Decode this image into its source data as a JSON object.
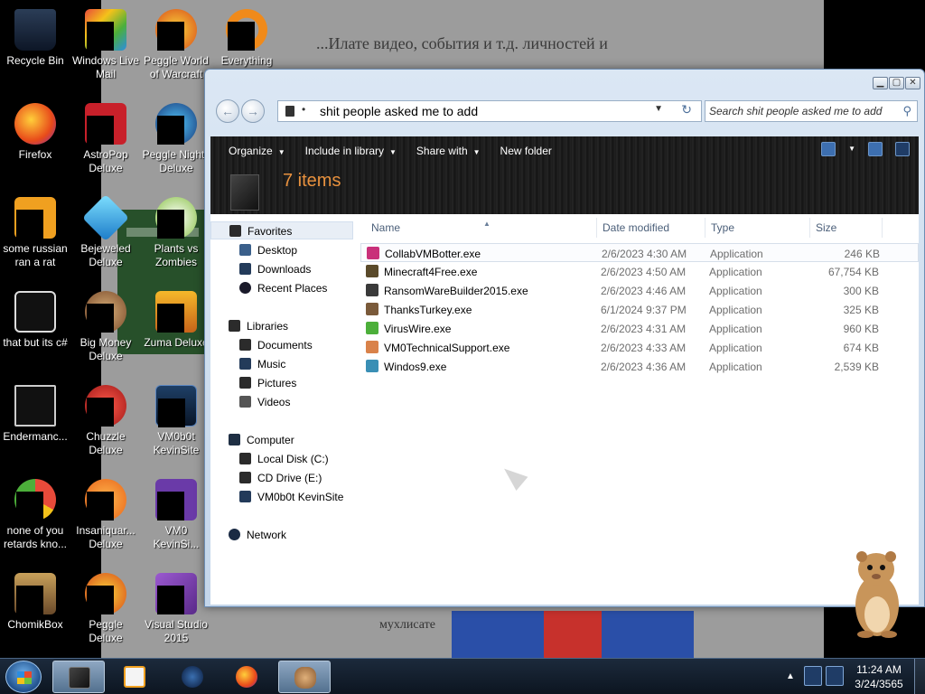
{
  "wallpaper": {
    "caption": "...Илате видео, события и т.д. личностей и",
    "bottom_text": "мухлисате"
  },
  "desktop": {
    "icons": [
      {
        "label": "Recycle Bin",
        "icon": "recycle-bin-icon"
      },
      {
        "label": "Windows Live Mail",
        "icon": "mail-icon"
      },
      {
        "label": "Peggle World of Warcraft",
        "icon": "peggle-icon"
      },
      {
        "label": "Everything",
        "icon": "search-magnifier-icon"
      },
      {
        "label": "Firefox",
        "icon": "firefox-icon"
      },
      {
        "label": "AstroPop Deluxe",
        "icon": "astropop-icon"
      },
      {
        "label": "Peggle Nights Deluxe",
        "icon": "peggle-nights-icon"
      },
      {
        "label": "some russian ran a rat",
        "icon": "app-icon"
      },
      {
        "label": "Bejeweled Deluxe",
        "icon": "bejeweled-icon"
      },
      {
        "label": "Plants vs Zombies",
        "icon": "pvz-icon"
      },
      {
        "label": "that but its c#",
        "icon": "windows-icon"
      },
      {
        "label": "Big Money Deluxe",
        "icon": "big-money-icon"
      },
      {
        "label": "Zuma Deluxe",
        "icon": "zuma-icon"
      },
      {
        "label": "Endermanc...",
        "icon": "app-window-icon"
      },
      {
        "label": "Chuzzle Deluxe",
        "icon": "chuzzle-icon"
      },
      {
        "label": "VM0b0t KevinSite",
        "icon": "monitor-icon"
      },
      {
        "label": "none of you retards kno...",
        "icon": "chrome-icon"
      },
      {
        "label": "Insaniquar... Deluxe",
        "icon": "insaniquarium-icon"
      },
      {
        "label": "VM0 KevinSi...",
        "icon": "app-icon"
      },
      {
        "label": "ChomikBox",
        "icon": "chomikbox-icon"
      },
      {
        "label": "Peggle Deluxe",
        "icon": "peggle-icon"
      },
      {
        "label": "Visual Studio 2015",
        "icon": "visual-studio-icon"
      }
    ]
  },
  "window": {
    "caption_buttons": {
      "minimize": "▁",
      "maximize": "▢",
      "close": "✕"
    },
    "back_glyph": "←",
    "forward_glyph": "→",
    "address": {
      "separator": "•",
      "path": "shit people asked me to add"
    },
    "search": {
      "placeholder": "Search shit people asked me to add"
    },
    "toolbar": {
      "organize": "Organize",
      "include_in_library": "Include in library",
      "share_with": "Share with",
      "new_folder": "New folder",
      "dropdown_glyph": "▼"
    },
    "details": {
      "items_count": "7 items"
    },
    "nav": {
      "favorites": "Favorites",
      "desktop": "Desktop",
      "downloads": "Downloads",
      "recent_places": "Recent Places",
      "libraries": "Libraries",
      "documents": "Documents",
      "music": "Music",
      "pictures": "Pictures",
      "videos": "Videos",
      "computer": "Computer",
      "local_disk": "Local Disk (C:)",
      "cd_drive": "CD Drive (E:)",
      "vm_drive": "VM0b0t KevinSite",
      "network": "Network"
    },
    "columns": {
      "name": "Name",
      "date": "Date modified",
      "type": "Type",
      "size": "Size"
    },
    "files": [
      {
        "name": "CollabVMBotter.exe",
        "date": "2/6/2023 4:30 AM",
        "type": "Application",
        "size": "246 KB",
        "color": "#c9307a"
      },
      {
        "name": "Minecraft4Free.exe",
        "date": "2/6/2023 4:50 AM",
        "type": "Application",
        "size": "67,754 KB",
        "color": "#5a4a2a"
      },
      {
        "name": "RansomWareBuilder2015.exe",
        "date": "2/6/2023 4:46 AM",
        "type": "Application",
        "size": "300 KB",
        "color": "#3a3a3a"
      },
      {
        "name": "ThanksTurkey.exe",
        "date": "6/1/2024 9:37 PM",
        "type": "Application",
        "size": "325 KB",
        "color": "#7a5a3a"
      },
      {
        "name": "VirusWire.exe",
        "date": "2/6/2023 4:31 AM",
        "type": "Application",
        "size": "960 KB",
        "color": "#4caf3a"
      },
      {
        "name": "VM0TechnicalSupport.exe",
        "date": "2/6/2023 4:33 AM",
        "type": "Application",
        "size": "674 KB",
        "color": "#d9824a"
      },
      {
        "name": "Windos9.exe",
        "date": "2/6/2023 4:36 AM",
        "type": "Application",
        "size": "2,539 KB",
        "color": "#3a8fb5"
      }
    ]
  },
  "taskbar": {
    "clock": {
      "time": "11:24 AM",
      "date": "3/24/3565"
    },
    "show_hidden": "▲"
  }
}
